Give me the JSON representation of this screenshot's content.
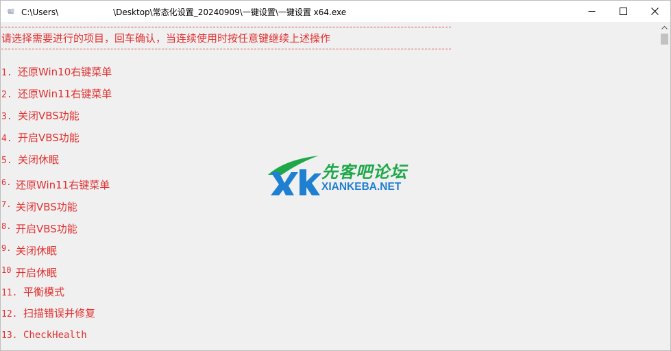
{
  "window": {
    "title_prefix": "C:\\Users\\",
    "title_suffix": "\\Desktop\\常态化设置_20240909\\一键设置\\一键设置 x64.exe",
    "icons": {
      "app": "console-app-icon",
      "minimize": "minimize-icon",
      "maximize": "maximize-icon",
      "close": "close-icon"
    }
  },
  "console": {
    "prompt": "请选择需要进行的项目，回车确认，当连续使用时按任意键继续上述操作",
    "items": [
      {
        "num": "1.",
        "label": "还原Win10右键菜单"
      },
      {
        "num": "2.",
        "label": "还原Win11右键菜单"
      },
      {
        "num": "3.",
        "label": "关闭VBS功能"
      },
      {
        "num": "4.",
        "label": "开启VBS功能"
      },
      {
        "num": "5.",
        "label": "关闭休眠"
      },
      {
        "num": "6.",
        "label": "还原Win11右键菜单"
      },
      {
        "num": "7.",
        "label": "关闭VBS功能"
      },
      {
        "num": "8.",
        "label": "开启VBS功能"
      },
      {
        "num": "9.",
        "label": "关闭休眠"
      },
      {
        "num": "10",
        "label": "开启休眠"
      },
      {
        "num": "11.",
        "label": "平衡模式"
      },
      {
        "num": "12.",
        "label": "扫描错误并修复"
      },
      {
        "num": "13.",
        "label": "CheckHealth"
      }
    ],
    "text_color": "#e03030"
  },
  "watermark": {
    "chinese": "先客吧论坛",
    "english": "XIANKEBA.NET",
    "green": "#1ea84a",
    "blue": "#1f7fd1"
  },
  "scrollbar": {
    "icon": "scroll-up-arrow-icon"
  }
}
